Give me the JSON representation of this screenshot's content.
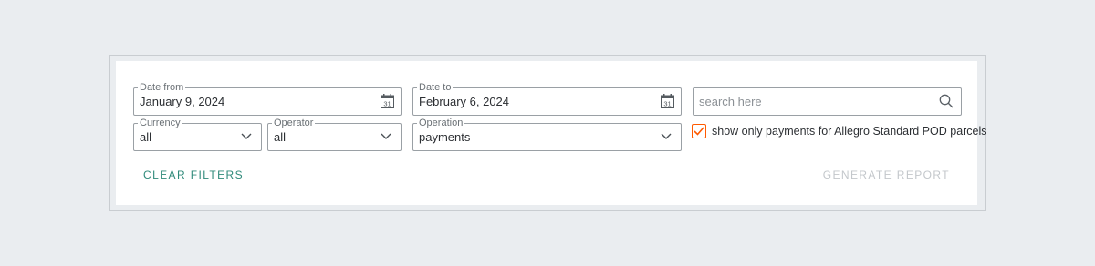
{
  "filters": {
    "date_from": {
      "label": "Date from",
      "value": "January 9, 2024"
    },
    "date_to": {
      "label": "Date to",
      "value": "February 6, 2024"
    },
    "search": {
      "placeholder": "search here"
    },
    "currency": {
      "label": "Currency",
      "value": "all"
    },
    "operator": {
      "label": "Operator",
      "value": "all"
    },
    "operation": {
      "label": "Operation",
      "value": "payments"
    },
    "only_allegro_pod": {
      "label": "show only payments for Allegro Standard POD parcels",
      "checked": true
    }
  },
  "actions": {
    "clear_label": "CLEAR FILTERS",
    "generate_label": "GENERATE REPORT"
  },
  "calendar_icon_day": "31",
  "colors": {
    "accent": "#ff5a00",
    "link": "#2f8a7a",
    "disabled": "#c3c7cb"
  }
}
